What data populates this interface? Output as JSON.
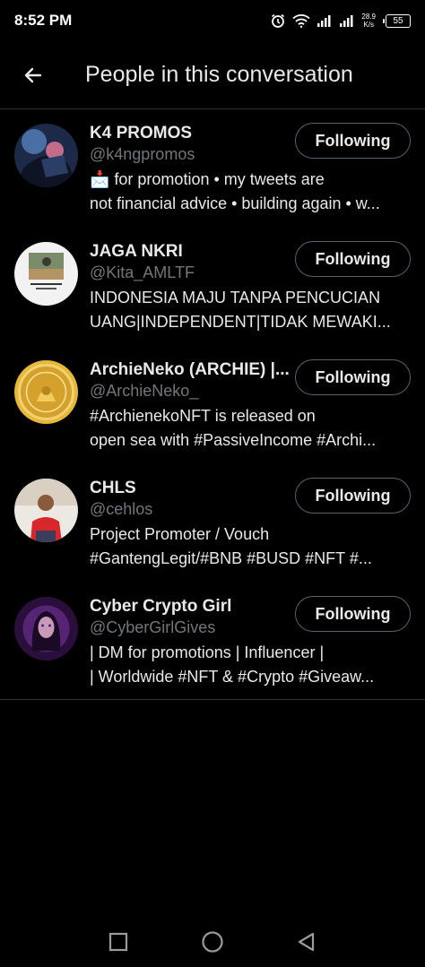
{
  "status": {
    "time": "8:52 PM",
    "net_speed_value": "28.9",
    "net_speed_unit": "K/s",
    "battery": "55"
  },
  "header": {
    "title": "People in this conversation"
  },
  "people": [
    {
      "name": "K4 PROMOS",
      "handle": "@k4ngpromos",
      "bio_line1": "📩 for promotion • my tweets are",
      "bio_line2": "not financial advice • building again • w...",
      "follow_label": "Following",
      "avatar_color": "#2a3b5e"
    },
    {
      "name": "JAGA NKRI",
      "handle": "@Kita_AMLTF",
      "bio_line1": "INDONESIA MAJU TANPA PENCUCIAN",
      "bio_line2": "UANG|INDEPENDENT|TIDAK MEWAKI...",
      "follow_label": "Following",
      "avatar_color": "#f4f4f4"
    },
    {
      "name": "ArchieNeko (ARCHIE) |...",
      "handle": "@ArchieNeko_",
      "bio_line1": "#ArchienekoNFT is released on",
      "bio_line2": "open sea with #PassiveIncome #Archi...",
      "follow_label": "Following",
      "avatar_color": "#d9a92a"
    },
    {
      "name": "CHLS",
      "handle": "@cehlos",
      "bio_line1": "Project Promoter / Vouch",
      "bio_line2": "#GantengLegit/#BNB #BUSD #NFT #...",
      "follow_label": "Following",
      "avatar_color": "#e8e4df"
    },
    {
      "name": "Cyber Crypto Girl",
      "handle": "@CyberGirlGives",
      "bio_line1": "| DM for promotions | Influencer |",
      "bio_line2": "| Worldwide #NFT & #Crypto #Giveaw...",
      "follow_label": "Following",
      "avatar_color": "#3a1a4e"
    }
  ]
}
